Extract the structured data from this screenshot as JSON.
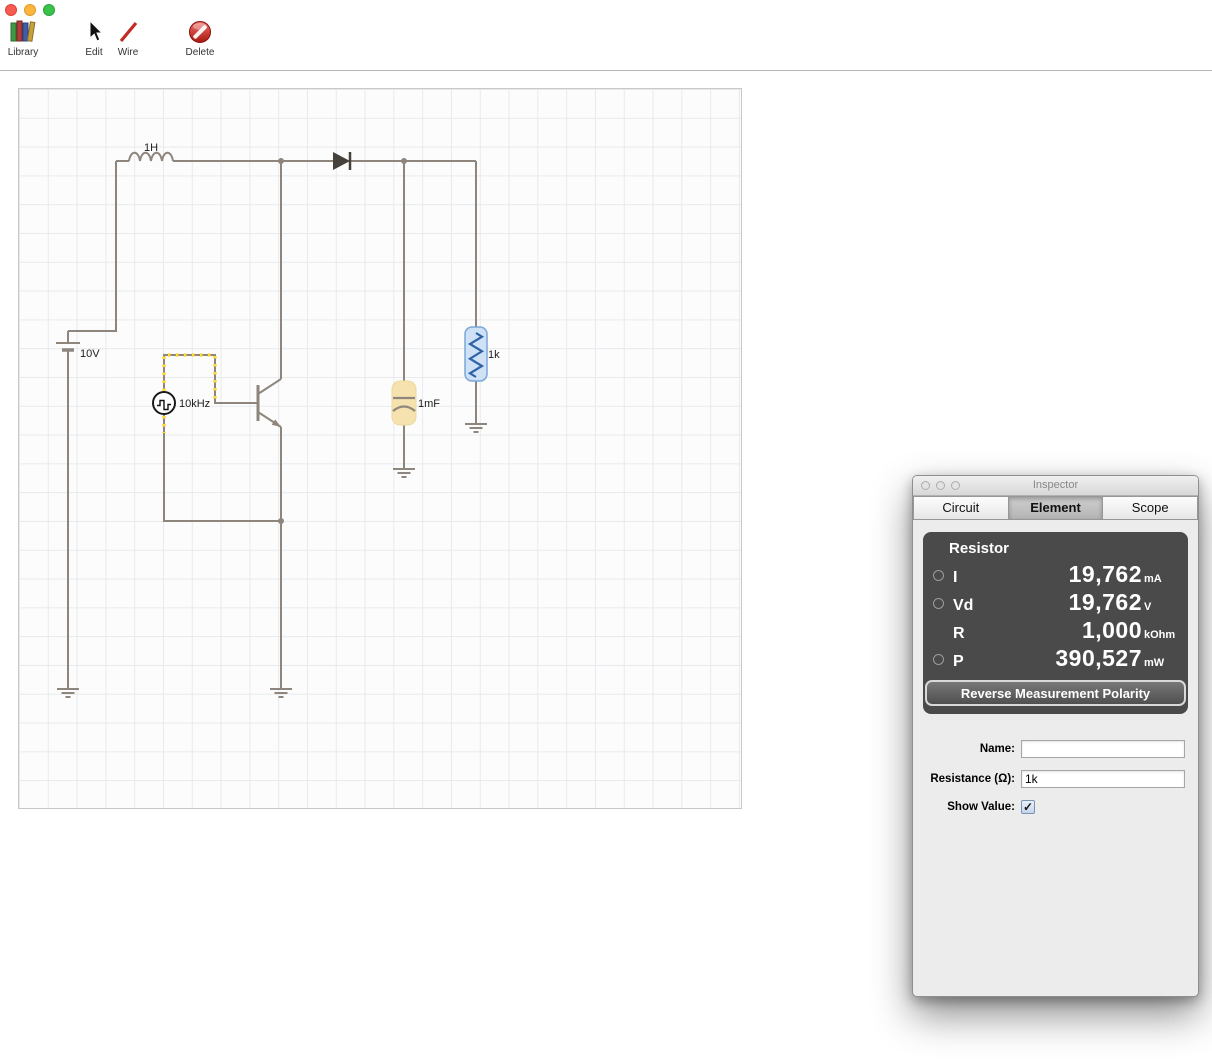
{
  "window": {
    "traffic_lights": [
      "close",
      "minimize",
      "zoom"
    ]
  },
  "toolbar": {
    "items": [
      {
        "label": "Library",
        "icon": "library-books-icon"
      },
      {
        "label": "Edit",
        "icon": "cursor-arrow-icon"
      },
      {
        "label": "Wire",
        "icon": "wire-line-icon"
      },
      {
        "label": "Delete",
        "icon": "prohibition-icon"
      }
    ]
  },
  "circuit": {
    "components": {
      "inductor": {
        "label": "1H"
      },
      "battery": {
        "label": "10V"
      },
      "square_wave_source": {
        "label": "10kHz"
      },
      "capacitor": {
        "label": "1mF",
        "highlighted": true
      },
      "resistor": {
        "label": "1k",
        "selected": true
      }
    },
    "wire_color": "#8e857c",
    "resistor_selection_color": "#cfe1f5",
    "capacitor_highlight_color": "#f6e2ae",
    "current_dot_color": "#ffd83a"
  },
  "inspector": {
    "title": "Inspector",
    "tabs": [
      {
        "label": "Circuit",
        "active": false
      },
      {
        "label": "Element",
        "active": true
      },
      {
        "label": "Scope",
        "active": false
      }
    ],
    "element_panel": {
      "title": "Resistor",
      "rows": [
        {
          "radio": true,
          "label": "I",
          "value": "19,762",
          "unit": "mA"
        },
        {
          "radio": true,
          "label": "Vd",
          "value": "19,762",
          "unit": "V"
        },
        {
          "radio": false,
          "label": "R",
          "value": "1,000",
          "unit": "kOhm"
        },
        {
          "radio": true,
          "label": "P",
          "value": "390,527",
          "unit": "mW"
        }
      ],
      "button_label": "Reverse Measurement Polarity"
    },
    "form": {
      "name_label": "Name:",
      "name_value": "",
      "resistance_label": "Resistance (Ω):",
      "resistance_value": "1k",
      "show_value_label": "Show Value:",
      "show_value_checked": true
    }
  }
}
